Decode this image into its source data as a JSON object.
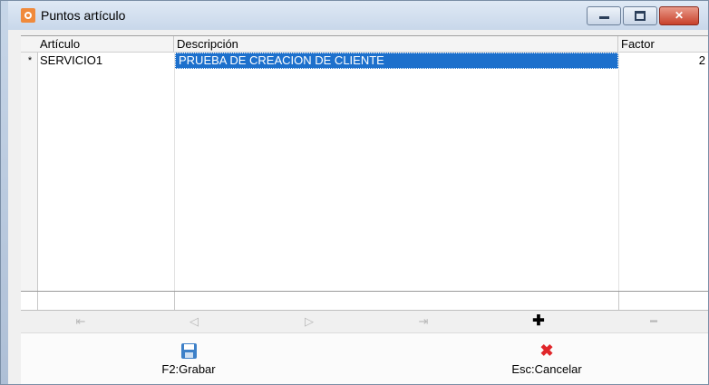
{
  "window": {
    "title": "Puntos artículo",
    "controls": [
      "minimize",
      "maximize",
      "close"
    ]
  },
  "grid": {
    "columns": [
      "Artículo",
      "Descripción",
      "Factor"
    ],
    "rows": [
      {
        "marker": "*",
        "articulo": "SERVICIO1",
        "descripcion": "PRUEBA DE CREACION DE CLIENTE",
        "factor": "2"
      }
    ]
  },
  "navigator": {
    "buttons": [
      "first-icon",
      "previous-icon",
      "next-icon",
      "last-icon",
      "add-icon",
      "remove-icon"
    ]
  },
  "actions": {
    "save_label": "F2:Grabar",
    "cancel_label": "Esc:Cancelar"
  },
  "colors": {
    "selection": "#1d70cc",
    "close_button": "#c8412b",
    "cancel_icon": "#e0262a",
    "save_icon": "#3d80c8"
  }
}
